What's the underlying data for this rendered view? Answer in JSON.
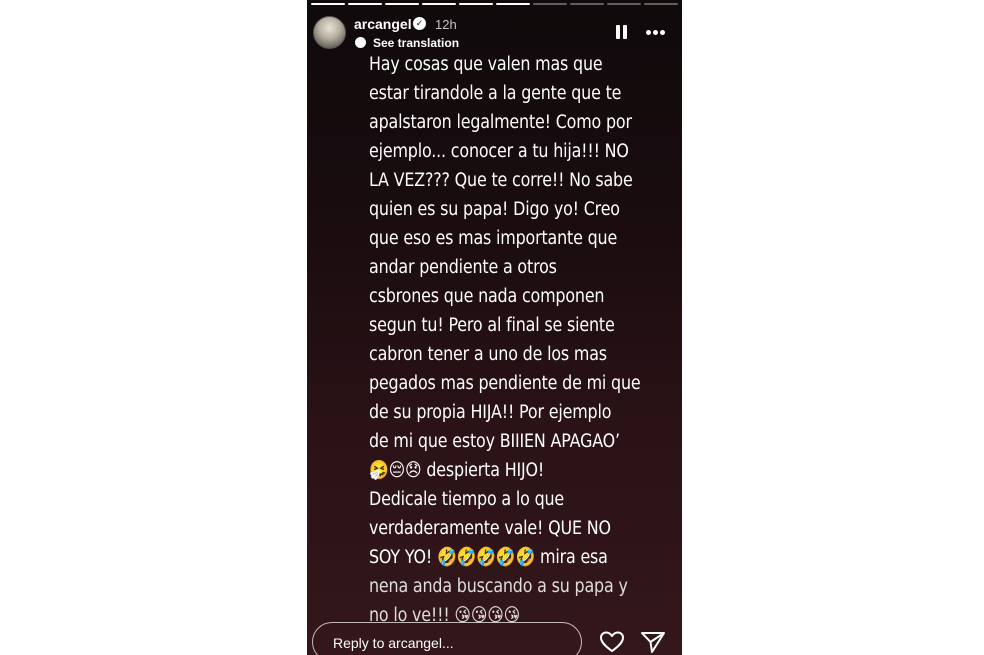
{
  "story": {
    "progress": {
      "total_segments": 10,
      "completed_segments": 6
    },
    "header": {
      "username": "arcangel",
      "time": "12h",
      "see_translation": "See translation"
    },
    "text_lines": [
      "Hay cosas que valen mas que",
      "estar tirandole a la gente que te",
      "apalstaron legalmente! Como por",
      "ejemplo... conocer a tu hija!!! NO",
      "LA VEZ??? Que te corre!! No sabe",
      "quien es su papa! Digo yo! Creo",
      "que eso es mas importante que",
      "andar pendiente a otros",
      "csbrones que nada componen",
      "segun tu! Pero al final se siente",
      "cabron tener a uno de los mas",
      "pegados mas pendiente de mi que",
      "de su propia HIJA!!  Por ejemplo",
      "de mi que estoy BIIIEN APAGAO’",
      "🤧😔😞 despierta HIJO!",
      "Dedicale tiempo a lo que",
      "verdaderamente vale! QUE NO",
      "SOY YO! 🤣🤣🤣🤣🤣 mira esa",
      "nena anda buscando a su papa y",
      "no lo ve!!! 😘😘😘😘"
    ],
    "reply": {
      "placeholder": "Reply to arcangel..."
    },
    "icons": {
      "pause": "pause-icon",
      "more": "more-options-icon",
      "like": "heart-icon",
      "share": "send-icon",
      "verified": "verified-badge-icon",
      "translate": "translate-bubble-icon"
    }
  }
}
